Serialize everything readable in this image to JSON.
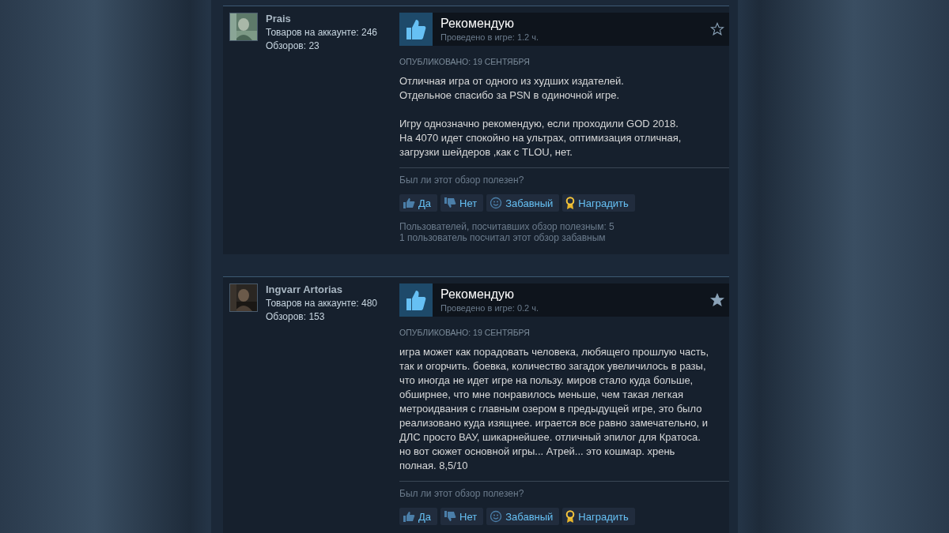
{
  "reviews": [
    {
      "author": {
        "name": "Prais",
        "products": "Товаров на аккаунте: 246",
        "reviews": "Обзоров: 23"
      },
      "verdict": "Рекомендую",
      "hours": "Проведено в игре: 1.2 ч.",
      "starred": false,
      "posted": "ОПУБЛИКОВАНО: 19 СЕНТЯБРЯ",
      "body": "Отличная игра от одного из худших издателей.\nОтдельное спасибо за PSN в одиночной игре.\n\nИгру однозначно рекомендую, если проходили GOD 2018.\nНа 4070 идет спокойно на ультрах, оптимизация отличная,\nзагрузки шейдеров ,как с TLOU, нет.",
      "question": "Был ли этот обзор полезен?",
      "buttons": [
        {
          "kind": "yes",
          "label": "Да"
        },
        {
          "kind": "no",
          "label": "Нет"
        },
        {
          "kind": "funny",
          "label": "Забавный"
        },
        {
          "kind": "award",
          "label": "Наградить"
        }
      ],
      "stats": [
        "Пользователей, посчитавших обзор полезным: 5",
        "1 пользователь посчитал этот обзор забавным"
      ]
    },
    {
      "author": {
        "name": "Ingvarr Artorias",
        "products": "Товаров на аккаунте: 480",
        "reviews": "Обзоров: 153"
      },
      "verdict": "Рекомендую",
      "hours": "Проведено в игре: 0.2 ч.",
      "starred": true,
      "posted": "ОПУБЛИКОВАНО: 19 СЕНТЯБРЯ",
      "body": "игра может как порадовать человека, любящего прошлую часть,\nтак и огорчить. боевка, количество загадок увеличилось в разы,\nчто иногда не идет игре на пользу. миров стало куда больше,\nобширнее, что мне понравилось меньше, чем такая легкая\nметроидвания с главным озером в предыдущей игре, это было\nреализовано куда изящнее. играется все равно замечательно, и\nДЛС просто ВАУ, шикарнейшее. отличный эпилог для Кратоса.\nно вот сюжет основной игры... Атрей... это кошмар. хрень\nполная. 8,5/10",
      "question": "Был ли этот обзор полезен?",
      "buttons": [
        {
          "kind": "yes",
          "label": "Да"
        },
        {
          "kind": "no",
          "label": "Нет"
        },
        {
          "kind": "funny",
          "label": "Забавный"
        },
        {
          "kind": "award",
          "label": "Наградить"
        }
      ]
    }
  ]
}
